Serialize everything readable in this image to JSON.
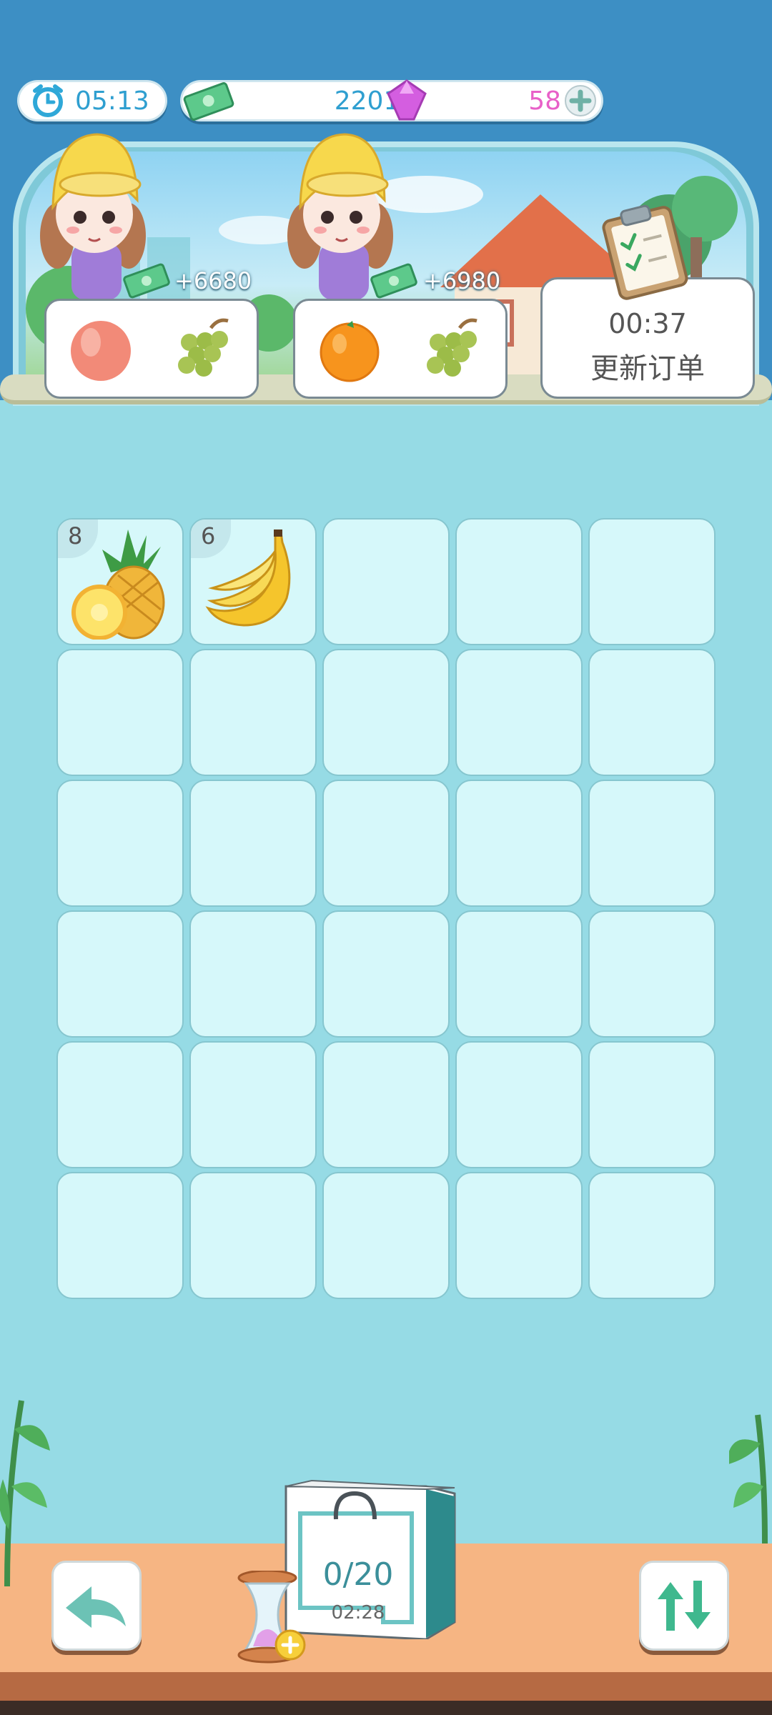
{
  "hud": {
    "timer": "05:13",
    "money": "22016",
    "gems": "58"
  },
  "orders": [
    {
      "reward": "+6680",
      "items": [
        "peach",
        "grapes"
      ]
    },
    {
      "reward": "+6980",
      "items": [
        "orange",
        "grapes"
      ]
    }
  ],
  "refresh": {
    "time": "00:37",
    "label": "更新订单"
  },
  "board": {
    "cells": [
      {
        "item": "pineapple",
        "qty": "8"
      },
      {
        "item": "banana",
        "qty": "6"
      }
    ]
  },
  "bag": {
    "count": "0/20",
    "timer": "02:28"
  },
  "icons": [
    "alarm-clock-icon",
    "cash-icon",
    "gem-icon",
    "plus-icon",
    "clipboard-icon",
    "back-arrow-icon",
    "sort-arrows-icon",
    "hourglass-icon"
  ],
  "colors": {
    "sky": "#3d8fc4",
    "board_bg": "#96dbe5",
    "cell": "#d6f8fa",
    "accent": "#2f9fd0",
    "gem": "#e860c8",
    "counter": "#f6b583"
  }
}
